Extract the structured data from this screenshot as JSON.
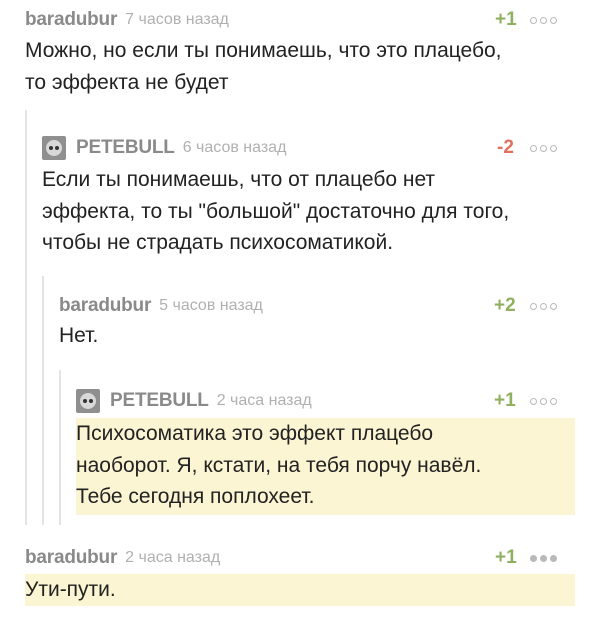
{
  "comments": [
    {
      "username": "baradubur",
      "time": "7 часов назад",
      "rating": "+1",
      "text_lines": [
        "Можно, но если ты понимаешь, что это плацебо,",
        "то эффекта не будет"
      ]
    },
    {
      "username": "PETEBULL",
      "time": "6 часов назад",
      "rating": "-2",
      "text_lines": [
        "Если ты понимаешь, что от плацебо нет",
        "эффекта, то ты \"большой\" достаточно для того,",
        "чтобы не страдать психосоматикой."
      ]
    },
    {
      "username": "baradubur",
      "time": "5 часов назад",
      "rating": "+2",
      "text_lines": [
        "Нет."
      ]
    },
    {
      "username": "PETEBULL",
      "time": "2 часа назад",
      "rating": "+1",
      "text_lines": [
        "Психосоматика это эффект плацебо",
        "наоборот. Я, кстати, на тебя порчу навёл.",
        "Тебе сегодня поплохеет."
      ]
    },
    {
      "username": "baradubur",
      "time": "2 часа назад",
      "rating": "+1",
      "text_lines": [
        "Ути-пути."
      ]
    }
  ],
  "colors": {
    "positive_rating": "#8fb15f",
    "negative_rating": "#e07060",
    "highlight_background": "#fbf5d3",
    "thread_line": "#e4e4e4"
  },
  "icons": {
    "avatar": "user-avatar-icon",
    "more": "more-options-icon"
  }
}
